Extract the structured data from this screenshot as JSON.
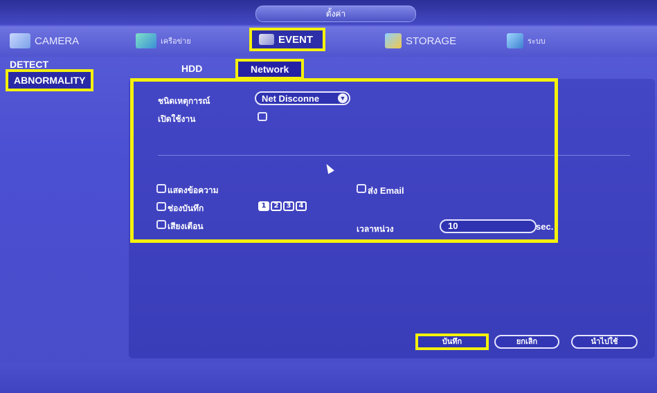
{
  "window": {
    "title": "ตั้งค่า"
  },
  "menu": {
    "items": [
      {
        "label": "CAMERA",
        "icon": "camera-icon"
      },
      {
        "label": "เครือข่าย",
        "icon": "network-icon"
      },
      {
        "label": "EVENT",
        "icon": "event-icon",
        "active": true
      },
      {
        "label": "STORAGE",
        "icon": "storage-icon"
      },
      {
        "label": "ระบบ",
        "icon": "system-icon"
      }
    ]
  },
  "sidebar": {
    "items": [
      {
        "label": "DETECT"
      },
      {
        "label": "ABNORMALITY",
        "active": true
      }
    ]
  },
  "subtabs": [
    {
      "label": "HDD"
    },
    {
      "label": "Network",
      "active": true
    }
  ],
  "form": {
    "event_type_label": "ชนิดเหตุการณ์",
    "event_type_value": "Net Disconne",
    "enable_label": "เปิดใช้งาน",
    "show_message_label": "แสดงข้อความ",
    "send_email_label": "ส่ง Email",
    "record_channel_label": "ช่องบันทึก",
    "channels": [
      "1",
      "2",
      "3",
      "4"
    ],
    "buzzer_label": "เสียงเตือน",
    "delay_label": "เวลาหน่วง",
    "delay_value": "10",
    "delay_unit": "sec."
  },
  "buttons": {
    "save": "บันทึก",
    "cancel": "ยกเลิก",
    "apply": "นำไปใช้"
  },
  "colors": {
    "highlight": "#f4f10c",
    "background": "#4a4fc8"
  }
}
